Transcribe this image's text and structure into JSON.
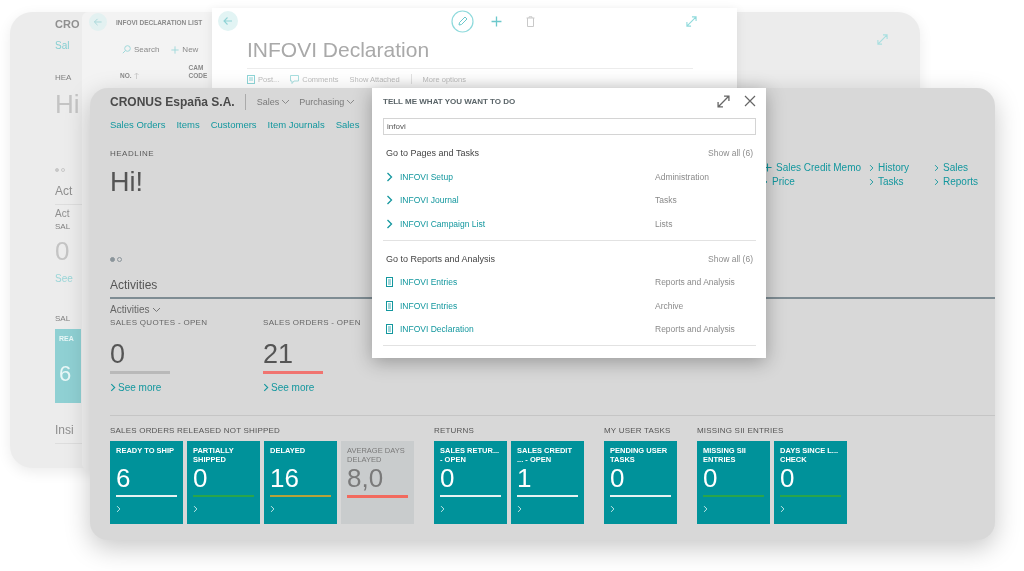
{
  "back_window": {
    "company": "CRO",
    "nav_link": "Sal",
    "headline_label": "HEA",
    "greeting": "Hi",
    "carousel": [
      {
        "selected": true
      },
      {
        "selected": false
      }
    ],
    "section": "Act",
    "dropdown": "Act",
    "cue_label": "SAL",
    "cue_value": "0",
    "see_more": "See",
    "tiles_label": "SAL",
    "tile": {
      "label": "REA",
      "value": "6"
    },
    "insights": "Insi"
  },
  "list_window": {
    "title": "INFOVI DECLARATION LIST",
    "actions": [
      "Search",
      "New"
    ],
    "columns": [
      "NO.",
      "CAM CODE"
    ]
  },
  "card_window": {
    "title": "INFOVI Declaration",
    "actions": [
      "Post...",
      "Comments",
      "Show Attached",
      "More options"
    ]
  },
  "main": {
    "company": "CRONUS España S.A.",
    "menus": [
      "Sales",
      "Purchasing"
    ],
    "nav_links": [
      "Sales Orders",
      "Items",
      "Customers",
      "Item Journals",
      "Sales"
    ],
    "headline": {
      "label": "HEADLINE",
      "text": "Hi!"
    },
    "carousel": [
      {
        "selected": true
      },
      {
        "selected": false
      }
    ],
    "actions": [
      {
        "kind": "new",
        "label": "Sales Credit Memo"
      },
      {
        "kind": "link",
        "label": "History"
      },
      {
        "kind": "link",
        "label": "Sales"
      },
      {
        "kind": "link",
        "label": "Price"
      },
      {
        "kind": "link",
        "label": "Tasks"
      },
      {
        "kind": "link",
        "label": "Reports"
      }
    ],
    "activities": {
      "title": "Activities",
      "dropdown": "Activities",
      "cues": [
        {
          "label": "SALES QUOTES - OPEN",
          "value": "0",
          "color": "#b9b9b9",
          "link": "See more"
        },
        {
          "label": "SALES ORDERS - OPEN",
          "value": "21",
          "color": "#f07470",
          "link": "See more"
        }
      ]
    },
    "tile_groups": [
      {
        "title": "SALES ORDERS RELEASED NOT SHIPPED",
        "tiles": [
          {
            "kind": "normal",
            "label": "READY TO SHIP",
            "value": "6",
            "color": "#e6f2f2"
          },
          {
            "kind": "normal",
            "label": "PARTIALLY SHIPPED",
            "value": "0",
            "color": "#2aa54b"
          },
          {
            "kind": "normal",
            "label": "DELAYED",
            "value": "16",
            "color": "#b7a23a"
          },
          {
            "kind": "neutral",
            "label": "AVERAGE DAYS DELAYED",
            "value": "8,0",
            "color": "#f26a5e"
          }
        ]
      },
      {
        "title": "RETURNS",
        "tiles": [
          {
            "kind": "normal",
            "label": "SALES RETUR... - OPEN",
            "value": "0",
            "color": "#e6f2f2"
          },
          {
            "kind": "normal",
            "label": "SALES CREDIT ... - OPEN",
            "value": "1",
            "color": "#e6f2f2"
          }
        ]
      },
      {
        "title": "MY USER TASKS",
        "tiles": [
          {
            "kind": "normal",
            "label": "PENDING USER TASKS",
            "value": "0",
            "color": "#e6f2f2"
          }
        ]
      },
      {
        "title": "MISSING SII ENTRIES",
        "tiles": [
          {
            "kind": "normal",
            "label": "MISSING SII ENTRIES",
            "value": "0",
            "color": "#2aa54b"
          },
          {
            "kind": "normal",
            "label": "DAYS SINCE L... CHECK",
            "value": "0",
            "color": "#2aa54b"
          }
        ]
      }
    ]
  },
  "tell_me": {
    "title": "TELL ME WHAT YOU WANT TO DO",
    "query": "infovi",
    "sections": [
      {
        "title": "Go to Pages and Tasks",
        "show_all": "Show all (6)",
        "results": [
          {
            "kind": "page",
            "name": "INFOVI Setup",
            "category": "Administration"
          },
          {
            "kind": "page",
            "name": "INFOVI Journal",
            "category": "Tasks"
          },
          {
            "kind": "page",
            "name": "INFOVI Campaign List",
            "category": "Lists"
          }
        ]
      },
      {
        "title": "Go to Reports and Analysis",
        "show_all": "Show all (6)",
        "results": [
          {
            "kind": "report",
            "name": "INFOVI Entries",
            "category": "Reports and Analysis"
          },
          {
            "kind": "report",
            "name": "INFOVI Entries",
            "category": "Archive"
          },
          {
            "kind": "report",
            "name": "INFOVI Declaration",
            "category": "Reports and Analysis"
          }
        ]
      }
    ]
  }
}
